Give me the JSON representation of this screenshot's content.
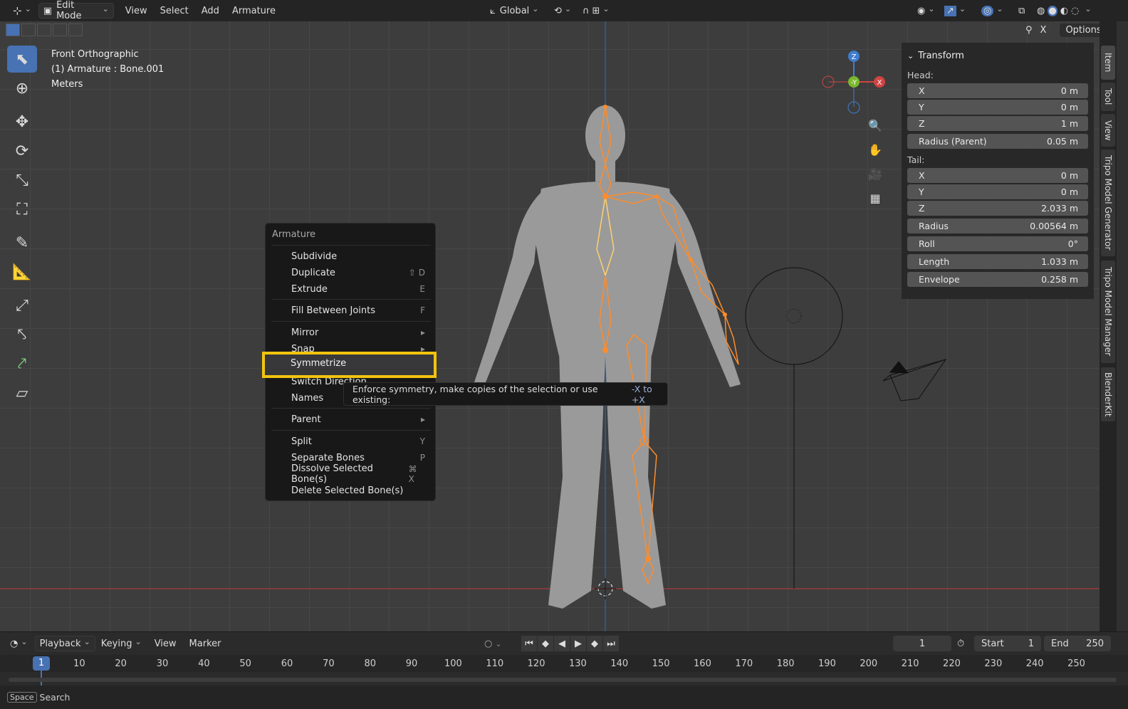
{
  "header": {
    "editor_icon": "viewport-icon",
    "mode": "Edit Mode",
    "menus": [
      "View",
      "Select",
      "Add",
      "Armature"
    ],
    "orientation": "Global",
    "options_label": "Options",
    "x_label": "X"
  },
  "viewport": {
    "view_name": "Front Orthographic",
    "object_info": "(1) Armature : Bone.001",
    "units": "Meters",
    "gizmo": {
      "z": "Z",
      "y": "-Y",
      "x": "X"
    }
  },
  "context_menu": {
    "title": "Armature",
    "items": [
      {
        "label": "Subdivide",
        "shortcut": ""
      },
      {
        "label": "Duplicate",
        "shortcut": "⇧ D"
      },
      {
        "label": "Extrude",
        "shortcut": "E"
      },
      {
        "label": "Fill Between Joints",
        "shortcut": "F"
      },
      {
        "label": "Mirror",
        "shortcut": "▸"
      },
      {
        "label": "Snap",
        "shortcut": "▸"
      },
      {
        "label": "Symmetrize",
        "shortcut": ""
      },
      {
        "label": "Switch Direction",
        "shortcut": ""
      },
      {
        "label": "Names",
        "shortcut": ""
      },
      {
        "label": "Parent",
        "shortcut": "▸"
      },
      {
        "label": "Split",
        "shortcut": "Y"
      },
      {
        "label": "Separate Bones",
        "shortcut": "P"
      },
      {
        "label": "Dissolve Selected Bone(s)",
        "shortcut": "⌘ X"
      },
      {
        "label": "Delete Selected Bone(s)",
        "shortcut": ""
      }
    ]
  },
  "tooltip": {
    "text": "Enforce symmetry, make copies of the selection or use existing:",
    "hint": "-X to +X"
  },
  "transform_panel": {
    "title": "Transform",
    "head_label": "Head:",
    "head": [
      {
        "label": "X",
        "value": "0 m"
      },
      {
        "label": "Y",
        "value": "0 m"
      },
      {
        "label": "Z",
        "value": "1 m"
      },
      {
        "label": "Radius (Parent)",
        "value": "0.05 m"
      }
    ],
    "tail_label": "Tail:",
    "tail": [
      {
        "label": "X",
        "value": "0 m"
      },
      {
        "label": "Y",
        "value": "0 m"
      },
      {
        "label": "Z",
        "value": "2.033 m"
      },
      {
        "label": "Radius",
        "value": "0.00564 m"
      },
      {
        "label": "Roll",
        "value": "0°"
      },
      {
        "label": "Length",
        "value": "1.033 m"
      },
      {
        "label": "Envelope",
        "value": "0.258 m"
      }
    ]
  },
  "side_tabs": [
    "Item",
    "Tool",
    "View",
    "Tripo Model Generator",
    "Tripo Model Manager",
    "BlenderKit"
  ],
  "timeline": {
    "menus": [
      "Playback",
      "Keying",
      "View",
      "Marker"
    ],
    "current_frame": "1",
    "start_label": "Start",
    "start_value": "1",
    "end_label": "End",
    "end_value": "250",
    "ticks": [
      "10",
      "20",
      "30",
      "40",
      "50",
      "60",
      "70",
      "80",
      "90",
      "100",
      "110",
      "120",
      "130",
      "140",
      "150",
      "160",
      "170",
      "180",
      "190",
      "200",
      "210",
      "220",
      "230",
      "240",
      "250"
    ],
    "playhead": "1"
  },
  "statusbar": {
    "key": "Space",
    "label": "Search"
  }
}
